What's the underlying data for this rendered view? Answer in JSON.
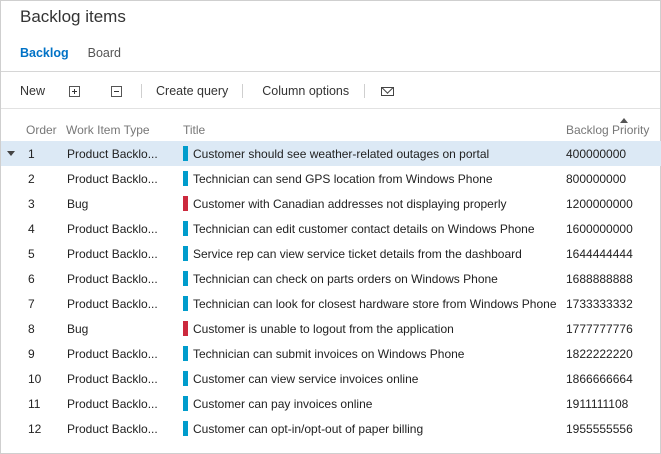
{
  "page": {
    "title": "Backlog items"
  },
  "tabs": [
    {
      "label": "Backlog",
      "active": true
    },
    {
      "label": "Board",
      "active": false
    }
  ],
  "toolbar": {
    "new_label": "New",
    "expand_icon": "expand-all-icon",
    "collapse_icon": "collapse-all-icon",
    "create_query_label": "Create query",
    "column_options_label": "Column options",
    "email_icon": "mail-icon"
  },
  "columns": {
    "order": "Order",
    "type": "Work Item Type",
    "title": "Title",
    "priority": "Backlog Priority"
  },
  "colors": {
    "product_backlog_item": "#009ccc",
    "bug": "#cc293d",
    "accent": "#0072c6",
    "selected_row": "#dce9f5"
  },
  "rows": [
    {
      "order": "1",
      "type": "Product Backlo...",
      "kind": "pbi",
      "title": "Customer should see weather-related outages on portal",
      "priority": "400000000",
      "selected": true
    },
    {
      "order": "2",
      "type": "Product Backlo...",
      "kind": "pbi",
      "title": "Technician can send GPS location from Windows Phone",
      "priority": "800000000"
    },
    {
      "order": "3",
      "type": "Bug",
      "kind": "bug",
      "title": "Customer with Canadian addresses not displaying properly",
      "priority": "1200000000"
    },
    {
      "order": "4",
      "type": "Product Backlo...",
      "kind": "pbi",
      "title": "Technician can edit customer contact details on Windows Phone",
      "priority": "1600000000"
    },
    {
      "order": "5",
      "type": "Product Backlo...",
      "kind": "pbi",
      "title": "Service rep can view service ticket details from the dashboard",
      "priority": "1644444444"
    },
    {
      "order": "6",
      "type": "Product Backlo...",
      "kind": "pbi",
      "title": "Technician can check on parts orders on Windows Phone",
      "priority": "1688888888"
    },
    {
      "order": "7",
      "type": "Product Backlo...",
      "kind": "pbi",
      "title": "Technician can look for closest hardware store from Windows Phone",
      "priority": "1733333332"
    },
    {
      "order": "8",
      "type": "Bug",
      "kind": "bug",
      "title": "Customer is unable to logout from the application",
      "priority": "1777777776"
    },
    {
      "order": "9",
      "type": "Product Backlo...",
      "kind": "pbi",
      "title": "Technician can submit invoices on Windows Phone",
      "priority": "1822222220"
    },
    {
      "order": "10",
      "type": "Product Backlo...",
      "kind": "pbi",
      "title": "Customer can view service invoices online",
      "priority": "1866666664"
    },
    {
      "order": "11",
      "type": "Product Backlo...",
      "kind": "pbi",
      "title": "Customer can pay invoices online",
      "priority": "1911111108"
    },
    {
      "order": "12",
      "type": "Product Backlo...",
      "kind": "pbi",
      "title": "Customer can opt-in/opt-out of paper billing",
      "priority": "1955555556"
    }
  ]
}
